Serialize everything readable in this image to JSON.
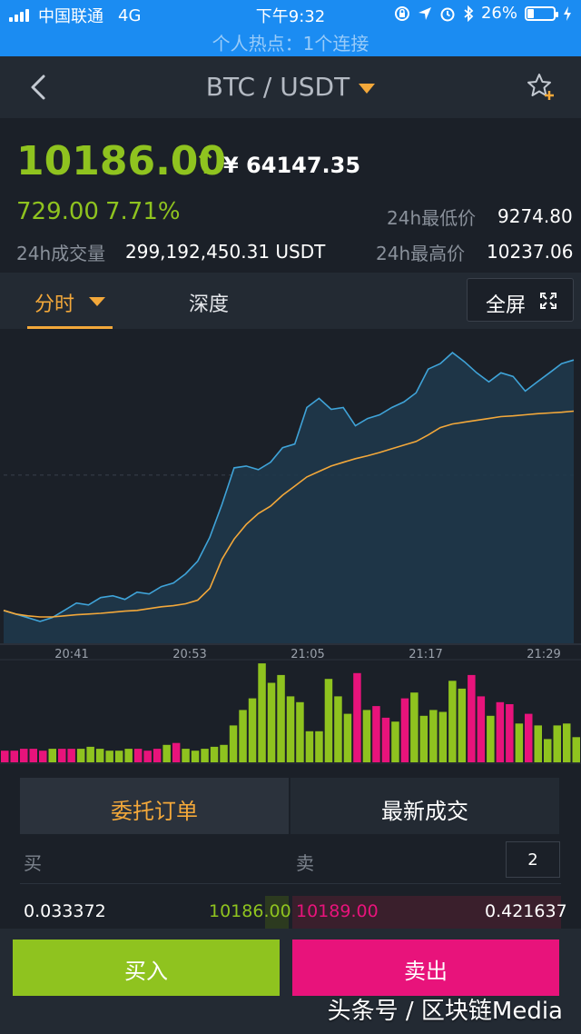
{
  "status_bar": {
    "carrier": "中国联通",
    "network": "4G",
    "time": "下午9:32",
    "battery_percent": "26%",
    "battery_level": 0.26,
    "hotspot": "个人热点：1个连接"
  },
  "header": {
    "pair": "BTC / USDT",
    "icons": {
      "back": "chevron-left-icon",
      "favorite": "star-plus-icon"
    }
  },
  "ticker": {
    "price": "10186.00",
    "arrow": "↑",
    "cny_price": "¥ 64147.35",
    "change": "729.00",
    "change_percent": "7.71%",
    "low_label": "24h最低价",
    "low_value": "9274.80",
    "volume_label": "24h成交量",
    "volume_value": "299,192,450.31 USDT",
    "high_label": "24h最高价",
    "high_value": "10237.06"
  },
  "tabs": {
    "timeshare": "分时",
    "depth": "深度",
    "fullscreen": "全屏"
  },
  "chart_data": {
    "type": "line",
    "x_ticks": [
      "20:41",
      "20:53",
      "21:05",
      "21:17",
      "21:29"
    ],
    "series": [
      {
        "role": "price",
        "color": "#3fa3d8",
        "values": [
          9540,
          9530,
          9520,
          9510,
          9520,
          9540,
          9560,
          9555,
          9575,
          9580,
          9570,
          9590,
          9585,
          9605,
          9615,
          9640,
          9675,
          9740,
          9830,
          9930,
          9935,
          9925,
          9945,
          9985,
          9995,
          10095,
          10120,
          10090,
          10095,
          10045,
          10065,
          10075,
          10095,
          10110,
          10135,
          10200,
          10215,
          10245,
          10220,
          10190,
          10165,
          10190,
          10180,
          10140,
          10165,
          10190,
          10215,
          10225
        ]
      },
      {
        "role": "average",
        "color": "#f3a83a",
        "values": [
          9540,
          9530,
          9525,
          9522,
          9522,
          9525,
          9528,
          9530,
          9532,
          9535,
          9538,
          9540,
          9545,
          9550,
          9553,
          9558,
          9568,
          9600,
          9680,
          9735,
          9775,
          9805,
          9825,
          9855,
          9880,
          9905,
          9920,
          9935,
          9945,
          9955,
          9963,
          9972,
          9982,
          9992,
          10002,
          10020,
          10040,
          10050,
          10055,
          10060,
          10065,
          10070,
          10072,
          10075,
          10078,
          10080,
          10082,
          10085
        ]
      }
    ],
    "y_range": [
      9450,
      10300
    ],
    "midline": 9910,
    "volume": {
      "colors": {
        "up": "#8fc31f",
        "down": "#e8137b"
      },
      "bars": [
        {
          "v": 6,
          "d": "down"
        },
        {
          "v": 6,
          "d": "down"
        },
        {
          "v": 7,
          "d": "down"
        },
        {
          "v": 7,
          "d": "down"
        },
        {
          "v": 6,
          "d": "down"
        },
        {
          "v": 7,
          "d": "up"
        },
        {
          "v": 7,
          "d": "down"
        },
        {
          "v": 7,
          "d": "down"
        },
        {
          "v": 7,
          "d": "up"
        },
        {
          "v": 8,
          "d": "up"
        },
        {
          "v": 7,
          "d": "up"
        },
        {
          "v": 6,
          "d": "up"
        },
        {
          "v": 6,
          "d": "up"
        },
        {
          "v": 7,
          "d": "up"
        },
        {
          "v": 7,
          "d": "down"
        },
        {
          "v": 6,
          "d": "down"
        },
        {
          "v": 7,
          "d": "down"
        },
        {
          "v": 9,
          "d": "up"
        },
        {
          "v": 10,
          "d": "down"
        },
        {
          "v": 7,
          "d": "up"
        },
        {
          "v": 6,
          "d": "up"
        },
        {
          "v": 7,
          "d": "up"
        },
        {
          "v": 8,
          "d": "up"
        },
        {
          "v": 9,
          "d": "up"
        },
        {
          "v": 19,
          "d": "up"
        },
        {
          "v": 27,
          "d": "up"
        },
        {
          "v": 33,
          "d": "up"
        },
        {
          "v": 51,
          "d": "up"
        },
        {
          "v": 41,
          "d": "up"
        },
        {
          "v": 45,
          "d": "up"
        },
        {
          "v": 34,
          "d": "up"
        },
        {
          "v": 31,
          "d": "up"
        },
        {
          "v": 16,
          "d": "up"
        },
        {
          "v": 16,
          "d": "up"
        },
        {
          "v": 43,
          "d": "up"
        },
        {
          "v": 34,
          "d": "up"
        },
        {
          "v": 25,
          "d": "up"
        },
        {
          "v": 46,
          "d": "down"
        },
        {
          "v": 27,
          "d": "up"
        },
        {
          "v": 29,
          "d": "down"
        },
        {
          "v": 23,
          "d": "down"
        },
        {
          "v": 21,
          "d": "up"
        },
        {
          "v": 33,
          "d": "down"
        },
        {
          "v": 36,
          "d": "up"
        },
        {
          "v": 24,
          "d": "up"
        },
        {
          "v": 27,
          "d": "up"
        },
        {
          "v": 26,
          "d": "up"
        },
        {
          "v": 42,
          "d": "up"
        },
        {
          "v": 38,
          "d": "up"
        },
        {
          "v": 45,
          "d": "down"
        },
        {
          "v": 34,
          "d": "down"
        },
        {
          "v": 24,
          "d": "up"
        },
        {
          "v": 31,
          "d": "down"
        },
        {
          "v": 30,
          "d": "down"
        },
        {
          "v": 20,
          "d": "up"
        },
        {
          "v": 25,
          "d": "down"
        },
        {
          "v": 19,
          "d": "up"
        },
        {
          "v": 12,
          "d": "up"
        },
        {
          "v": 19,
          "d": "up"
        },
        {
          "v": 20,
          "d": "up"
        },
        {
          "v": 13,
          "d": "up"
        }
      ]
    }
  },
  "orders": {
    "tab_orders": "委托订单",
    "tab_trades": "最新成交",
    "buy_label": "买",
    "sell_label": "卖",
    "depth_value": "2",
    "row": {
      "buy_amount": "0.033372",
      "buy_price": "10186.00",
      "sell_price": "10189.00",
      "sell_amount": "0.421637"
    }
  },
  "actions": {
    "buy": "买入",
    "sell": "卖出"
  },
  "watermark": "头条号 / 区块链Media",
  "colors": {
    "up": "#8fc31f",
    "down": "#e8137b",
    "accent": "#f3a83a",
    "status_blue": "#1b8cf2"
  }
}
